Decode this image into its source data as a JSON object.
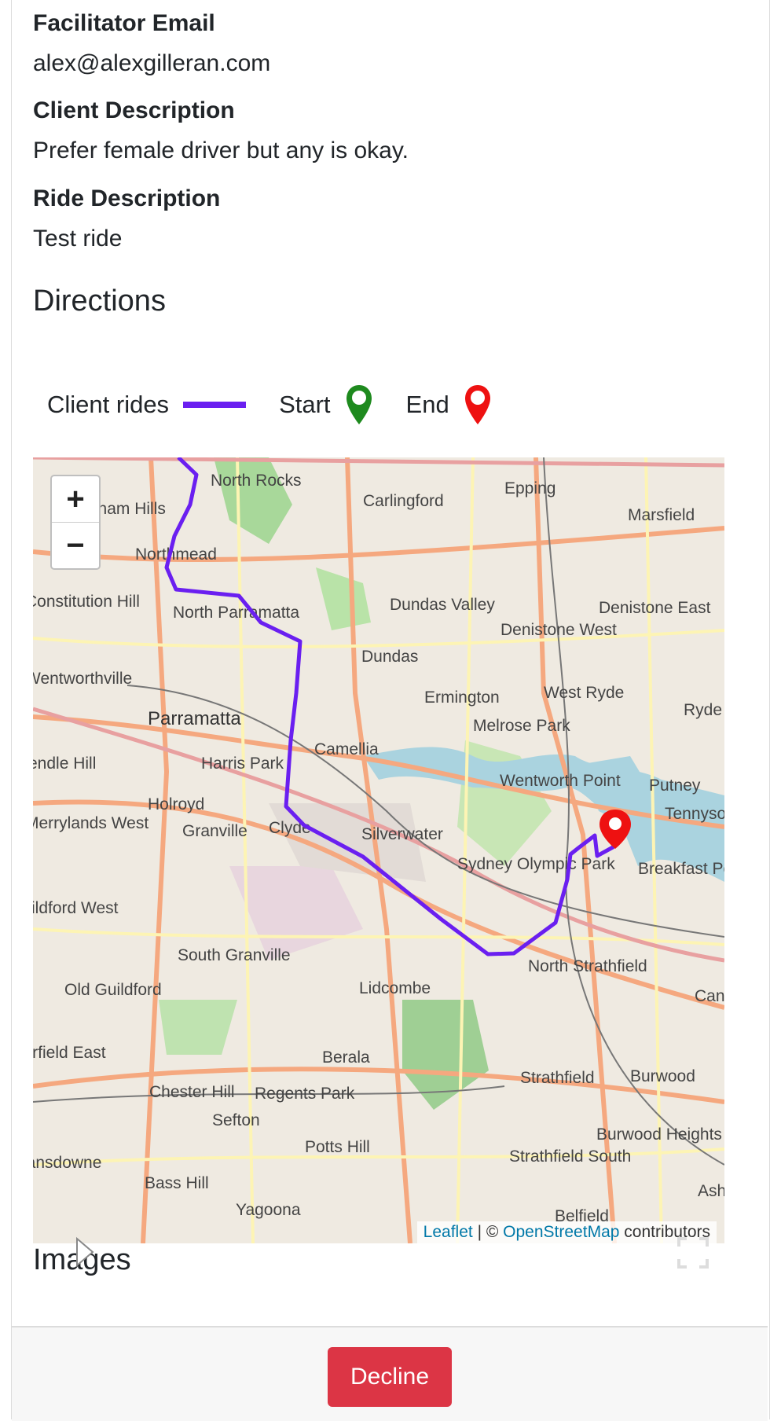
{
  "facilitator": {
    "label": "Facilitator Email",
    "value": "alex@alexgilleran.com"
  },
  "client_description": {
    "label": "Client Description",
    "value": "Prefer female driver but any is okay."
  },
  "ride_description": {
    "label": "Ride Description",
    "value": "Test ride"
  },
  "directions": {
    "heading": "Directions"
  },
  "legend": {
    "client_rides_label": "Client rides",
    "client_rides_color": "#6a1ff0",
    "start_label": "Start",
    "start_color": "#1e8a1e",
    "end_label": "End",
    "end_color": "#ee1111"
  },
  "map": {
    "zoom_in": "+",
    "zoom_out": "−",
    "attribution": {
      "leaflet": "Leaflet",
      "sep": " | © ",
      "osm": "OpenStreetMap",
      "contributors": " contributors"
    },
    "places": [
      "North Rocks",
      "Carlingford",
      "Epping",
      "Marsfield",
      "Baulkham Hills",
      "Northmead",
      "Constitution Hill",
      "North Parramatta",
      "Dundas Valley",
      "Denistone East",
      "Denistone West",
      "Dundas",
      "Ermington",
      "West Ryde",
      "Ryde",
      "Wentworthville",
      "Parramatta",
      "Melrose Park",
      "Camellia",
      "Harris Park",
      "Pendle Hill",
      "Holroyd",
      "Wentworth Point",
      "Putney",
      "Tennyson",
      "Merrylands West",
      "Granville",
      "Clyde",
      "Silverwater",
      "Sydney Olympic Park",
      "Breakfast Point",
      "Guildford West",
      "South Granville",
      "Old Guildford",
      "Lidcombe",
      "North Strathfield",
      "Canada Bay",
      "Fairfield East",
      "Berala",
      "Strathfield",
      "Burwood",
      "Chester Hill",
      "Regents Park",
      "Sefton",
      "Burwood Heights",
      "Potts Hill",
      "Strathfield South",
      "Lansdowne",
      "Bass Hill",
      "Yagoona",
      "Ashfield",
      "Belfield"
    ],
    "icons": {
      "zoom_in": "plus-icon",
      "zoom_out": "minus-icon",
      "fullscreen": "fullscreen-icon",
      "start": "start-marker-icon",
      "end": "end-marker-icon"
    }
  },
  "images": {
    "heading": "Images"
  },
  "actions": {
    "decline_label": "Decline",
    "decline_color": "#dc3545"
  }
}
